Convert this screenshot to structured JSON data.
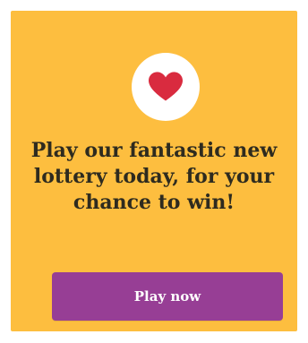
{
  "colors": {
    "card_background": "#fdbe3f",
    "button_background": "#973e95",
    "heart": "#d92b3f",
    "text": "#2e2b1f"
  },
  "promo": {
    "icon": "heart-icon",
    "headline": "Play our fantastic new lottery today, for your chance to win!",
    "button_label": "Play now"
  }
}
